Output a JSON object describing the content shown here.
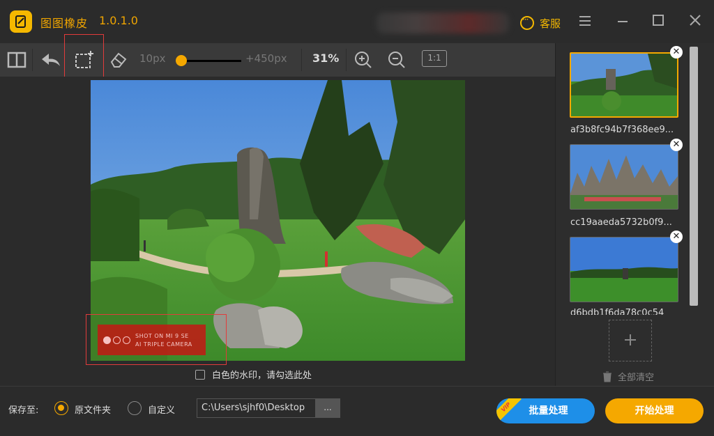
{
  "app": {
    "title": "图图橡皮",
    "version": "1.0.1.0",
    "service_label": "客服"
  },
  "window_controls": [
    "menu-icon",
    "minimize-icon",
    "maximize-icon",
    "close-icon"
  ],
  "toolbar": {
    "tools": [
      "compare-icon",
      "undo-icon",
      "crop-select-icon",
      "eraser-icon"
    ],
    "brush_min": "10px",
    "brush_max": "+450px",
    "brush_size_fraction": 0.02,
    "zoom": "31%",
    "actual_size": "1:1"
  },
  "canvas": {
    "white_watermark_label": "白色的水印，请勾选此处",
    "white_watermark_checked": false,
    "watermark_line1": "SHOT ON MI 9 SE",
    "watermark_line2": "AI TRIPLE CAMERA"
  },
  "files": [
    {
      "name": "af3b8fc94b7f368ee9...",
      "active": true
    },
    {
      "name": "cc19aaeda5732b0f9...",
      "active": false
    },
    {
      "name": "d6bdb1f6da78c0c54",
      "active": false
    }
  ],
  "clear_all_label": "全部清空",
  "bottom": {
    "save_to_label": "保存至:",
    "option_original": "原文件夹",
    "option_custom": "自定义",
    "selected_option": "原文件夹",
    "path_value": "C:\\Users\\sjhf0\\Desktop",
    "browse_label": "...",
    "batch_label": "批量处理",
    "vip_badge": "VIP",
    "start_label": "开始处理"
  },
  "colors": {
    "accent": "#f5a800",
    "batch_blue": "#1e8fe8",
    "highlight_red": "#e23b3b"
  }
}
